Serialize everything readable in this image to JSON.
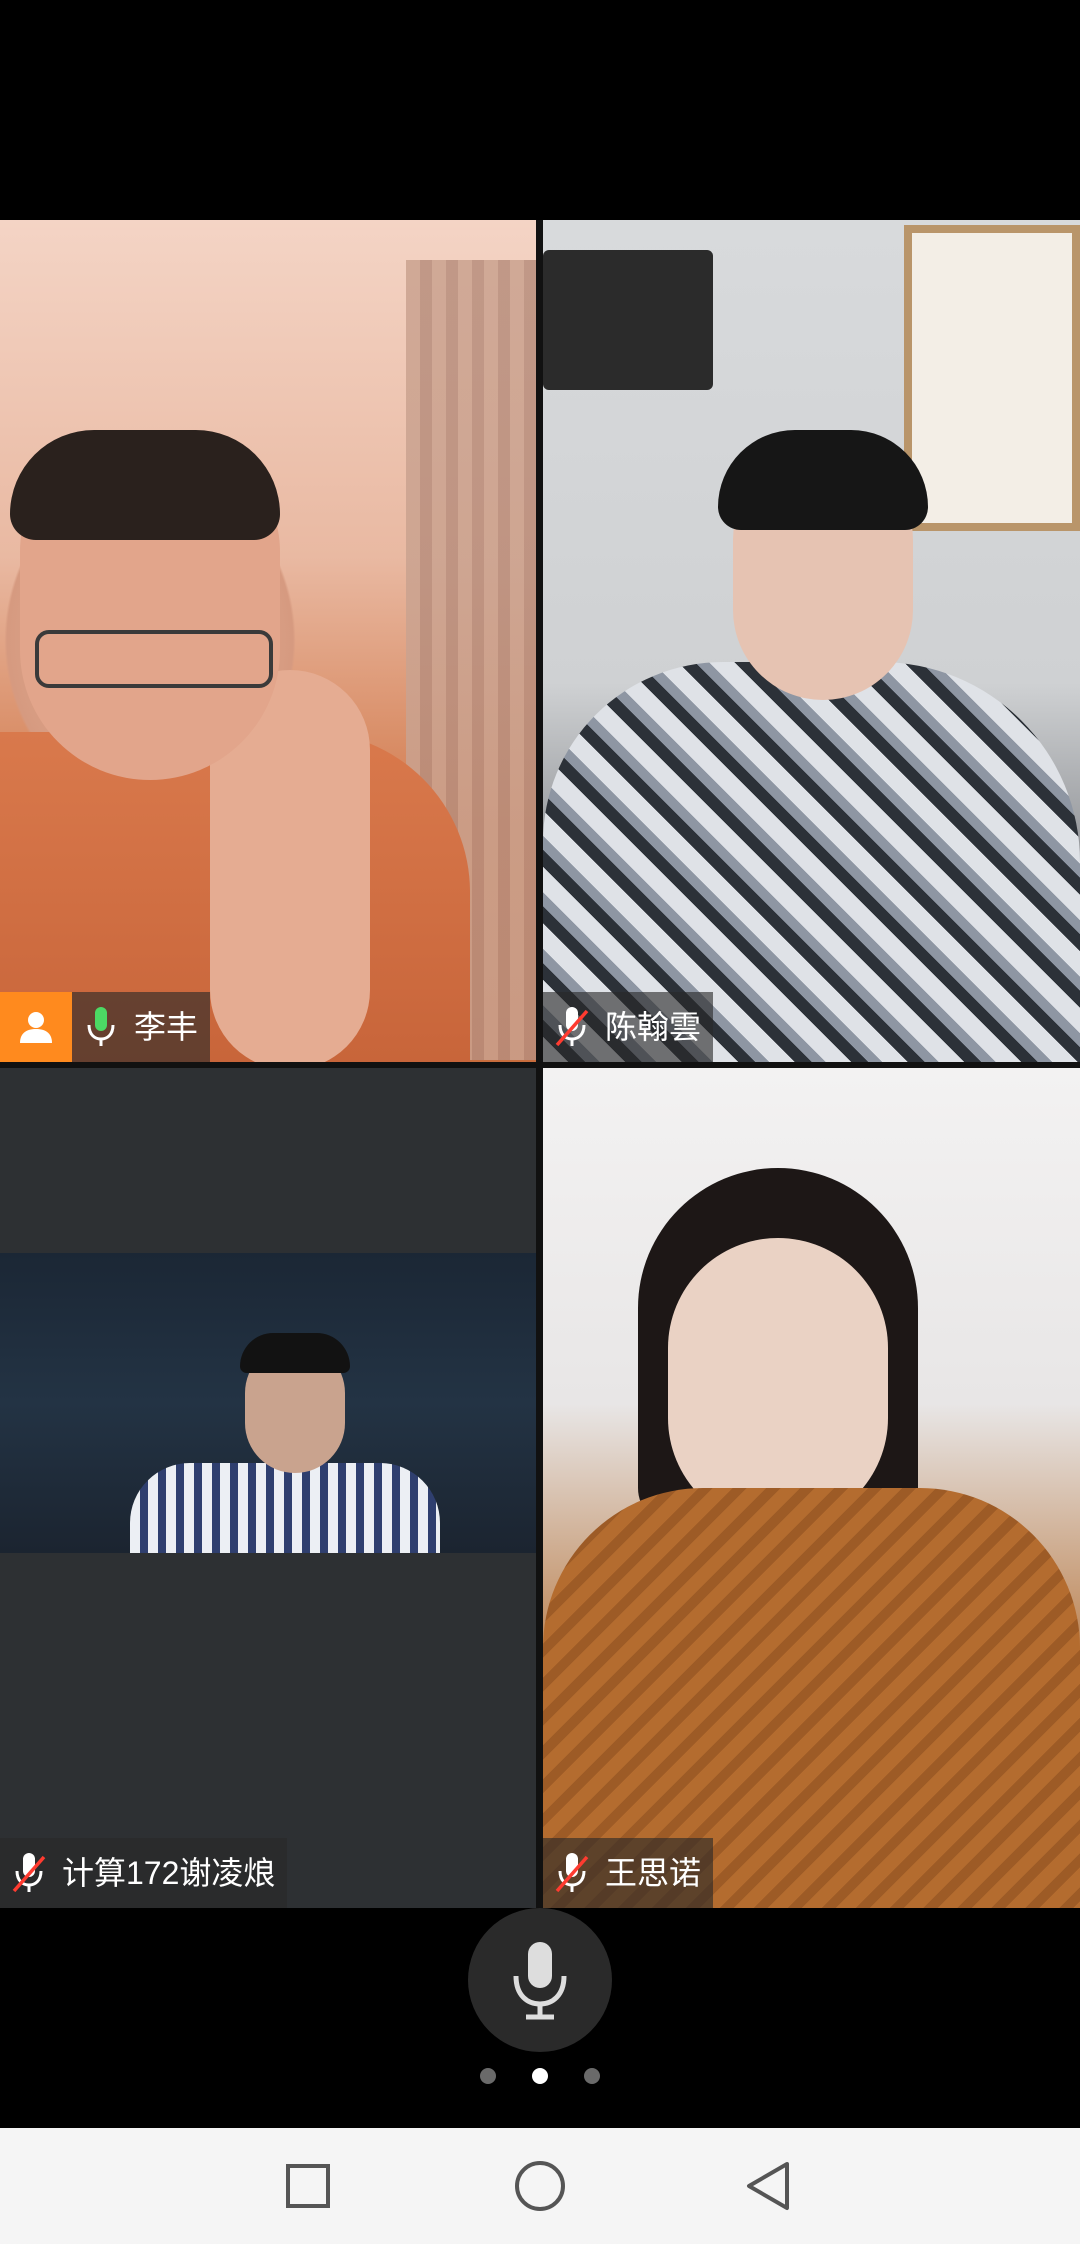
{
  "meeting": {
    "participants": [
      {
        "name": "李丰",
        "mic": "on",
        "host": true
      },
      {
        "name": "陈翰雲",
        "mic": "muted",
        "host": false
      },
      {
        "name": "计算172谢凌烺",
        "mic": "muted",
        "host": false
      },
      {
        "name": "王思诺",
        "mic": "muted",
        "host": false
      }
    ]
  },
  "controls": {
    "mute_icon": "microphone-icon",
    "pages": [
      false,
      true,
      false
    ]
  },
  "navbar": {
    "recent_icon": "square-icon",
    "home_icon": "circle-icon",
    "back_icon": "triangle-back-icon"
  },
  "colors": {
    "host_badge": "#ff8a1e",
    "mic_on": "#4cd964",
    "mic_muted_slash": "#ff3b30"
  }
}
